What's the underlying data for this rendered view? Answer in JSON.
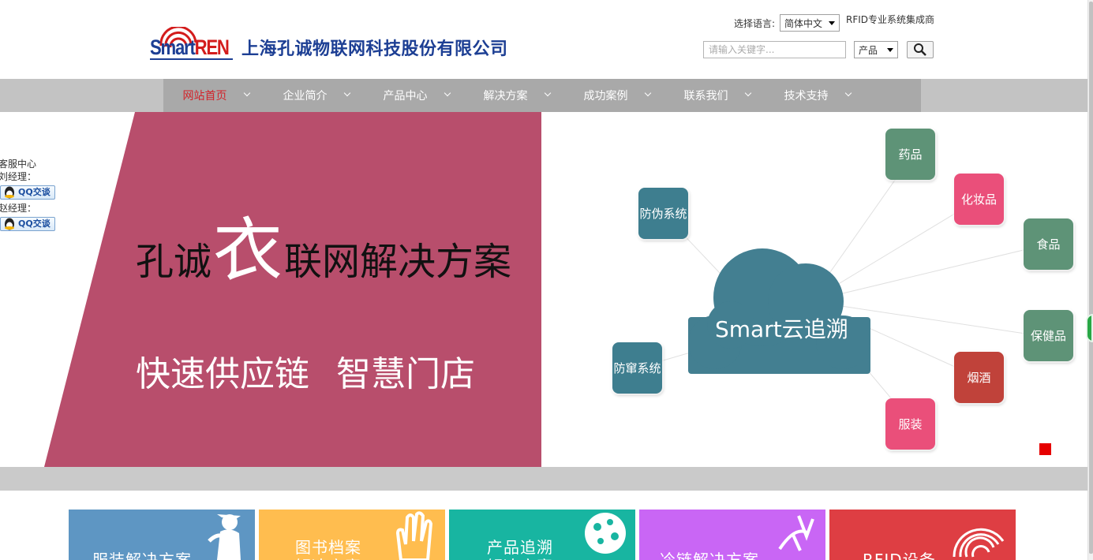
{
  "header": {
    "logo_smart": "Smart",
    "logo_ren": "REN",
    "company_name": "上海孔诚物联网科技股份有限公司",
    "lang_label": "选择语言:",
    "lang_value": "简体中文",
    "tagline": "RFID专业系统集成商",
    "search_placeholder": "请输入关键字...",
    "category_value": "产品"
  },
  "nav": {
    "items": [
      {
        "label": "网站首页"
      },
      {
        "label": "企业简介"
      },
      {
        "label": "产品中心"
      },
      {
        "label": "解决方案"
      },
      {
        "label": "成功案例"
      },
      {
        "label": "联系我们"
      },
      {
        "label": "技术支持"
      }
    ]
  },
  "banner": {
    "headline_pre": "孔诚",
    "headline_big": "衣",
    "headline_post": "联网解决方案",
    "sub_1": "快速供应链",
    "sub_2": "智慧门店",
    "cloud_label": "Smart云追溯",
    "nodes": {
      "anti_fake": "防伪系统",
      "anti_fleeing": "防窜系统",
      "medicine": "药品",
      "cosmetics": "化妆品",
      "food": "食品",
      "health": "保健品",
      "tobacco": "烟酒",
      "clothing": "服装"
    }
  },
  "service": {
    "title": "客服中心",
    "agent_1": "刘经理：",
    "agent_2": "赵经理：",
    "qq_label": "QQ交谈"
  },
  "tiles": [
    {
      "line1": "服装解决方案",
      "line2": ""
    },
    {
      "line1": "图书档案",
      "line2": "解决方案"
    },
    {
      "line1": "产品追溯",
      "line2": "解决方案"
    },
    {
      "line1": "冷链解决方案",
      "line2": ""
    },
    {
      "line1": "RFID设备",
      "line2": ""
    }
  ],
  "colors": {
    "brand_blue": "#1d3f94",
    "brand_red": "#d31c1c",
    "banner_magenta": "#b84e6c",
    "tile_blue": "#5e96c3",
    "tile_yellow": "#ffbd4f",
    "tile_teal": "#18b5a1",
    "tile_purple": "#c966f5",
    "tile_red": "#de3e43"
  }
}
